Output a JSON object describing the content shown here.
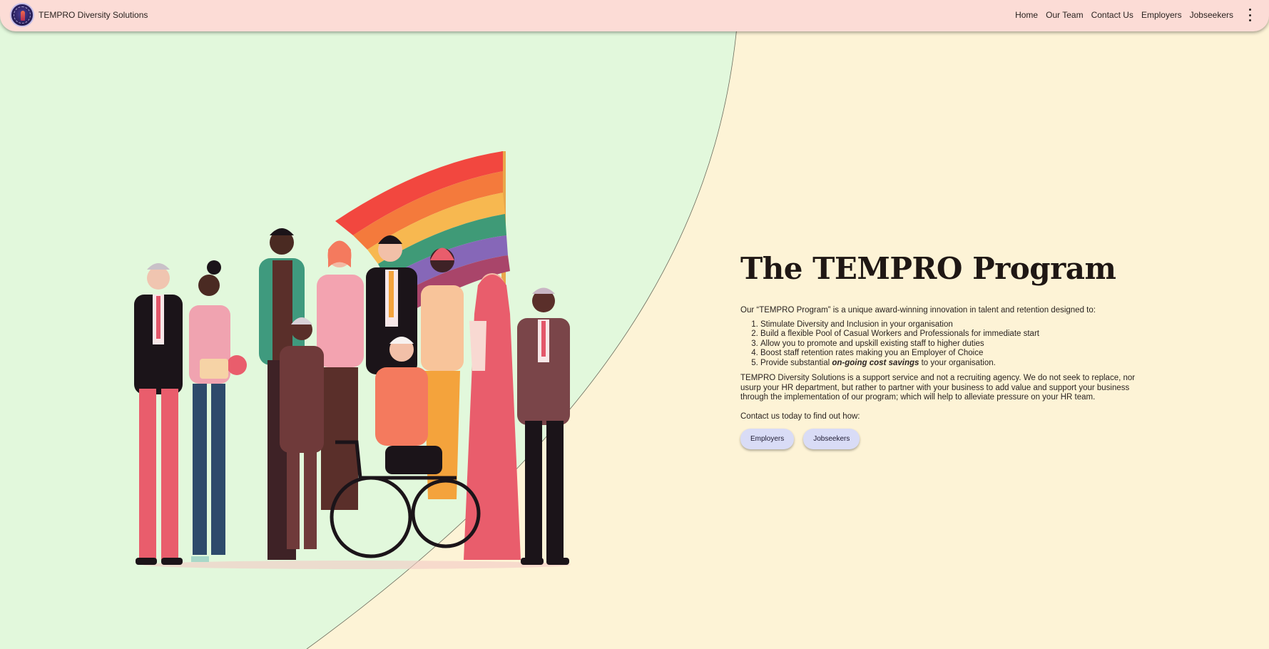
{
  "header": {
    "site_title": "TEMPRO Diversity Solutions",
    "logo_icon": "tempro-logo",
    "nav": [
      "Home",
      "Our Team",
      "Contact Us",
      "Employers",
      "Jobseekers"
    ],
    "menu_icon": "more-vert-icon"
  },
  "colors": {
    "header_bg": "#fcdcd6",
    "left_bg": "#e2f8dc",
    "right_bg": "#fdf3d6",
    "button_bg": "#d9dcf6"
  },
  "main": {
    "illustration": "diverse-people-with-rainbow-flag-illustration",
    "heading": "The TEMPRO Program",
    "intro": "Our “TEMPRO Program” is a unique award-winning innovation in talent and retention designed to:",
    "benefits": [
      "Stimulate Diversity and Inclusion in your organisation",
      "Build a flexible Pool of Casual Workers and Professionals for immediate start",
      "Allow you to promote and upskill existing staff to higher duties",
      "Boost staff retention rates making you an Employer of Choice"
    ],
    "benefit5_prefix": "Provide substantial ",
    "benefit5_emphasis": "on-going cost savings",
    "benefit5_suffix": " to your organisation.",
    "paragraph": "TEMPRO Diversity Solutions is a support service and not a recruiting agency. We do not seek to replace, nor usurp your HR department, but rather to partner with your business to add value and support your business through the implementation of our program; which will help to alleviate pressure on your HR team.",
    "contact_text": "Contact us today to find out how:",
    "buttons": [
      "Employers",
      "Jobseekers"
    ]
  }
}
